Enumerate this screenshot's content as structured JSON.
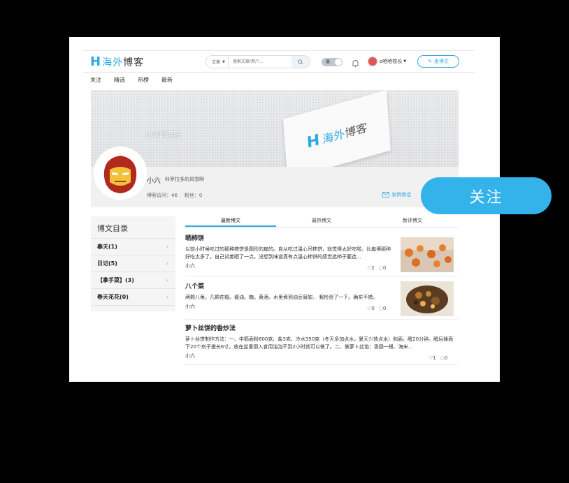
{
  "header": {
    "logo_h": "H",
    "logo_part1": "海外",
    "logo_part2": "博客",
    "search_type": "文章",
    "search_placeholder": "搜索文章/用户...",
    "toggle_label": "黑",
    "username": "o哈哈校长",
    "post_button": "发博文"
  },
  "nav": [
    "关注",
    "精选",
    "热榜",
    "最新"
  ],
  "banner": {
    "blog_title": "小六的博客",
    "card_h": "H",
    "card_part1": "海外",
    "card_part2": "博客",
    "name": "小六",
    "motto": "科罗拉多的风雪啊",
    "visits": "博客访问：46",
    "fans": "粉丝：0",
    "message": "发悄悄话"
  },
  "sidebar": {
    "title": "博文目录",
    "categories": [
      "秦天(1)",
      "日记(5)",
      "【拿手菜】(3)",
      "春天花花(0)"
    ]
  },
  "tabs": [
    "最新博文",
    "最热博文",
    "新评博文"
  ],
  "posts": [
    {
      "title": "晒柿饼",
      "excerpt": "以前小时候吃过的那种柿饼是圆形的扁的。自从吃过温心吊柿饼，就觉得太好吃啦。比扁博那种好吃太多了。自己试着晒了一点。没想到味道真有点温心柿饼的感觉选柿子要选...",
      "author": "小六",
      "likes": "2",
      "comments": "0"
    },
    {
      "title": "八个菜",
      "excerpt": "两颗八角。几颗花椒。酱油。糖。黄酒。水里煮到油豆腐软。 我检验了一下。确实不错。",
      "author": "小六",
      "likes": "0",
      "comments": "0"
    },
    {
      "title": "萝卜丝饼的香炒法",
      "excerpt": "萝卜丝饼制作方法：一、中筋面粉600克、盐3克、冷水350克（冬天多加点水，夏天少放点水）和面。醒20分钟。醒后揉面下20个剂子搓长6寸。放在盆里倒入食用油泡不到2小时就可以做了。二、做萝卜丝馅：香肠一根、海米...",
      "author": "小六",
      "likes": "1",
      "comments": "0"
    }
  ],
  "follow_button": "关注",
  "colors": {
    "accent": "#34b3ea",
    "brand": "#2fa8e6"
  }
}
